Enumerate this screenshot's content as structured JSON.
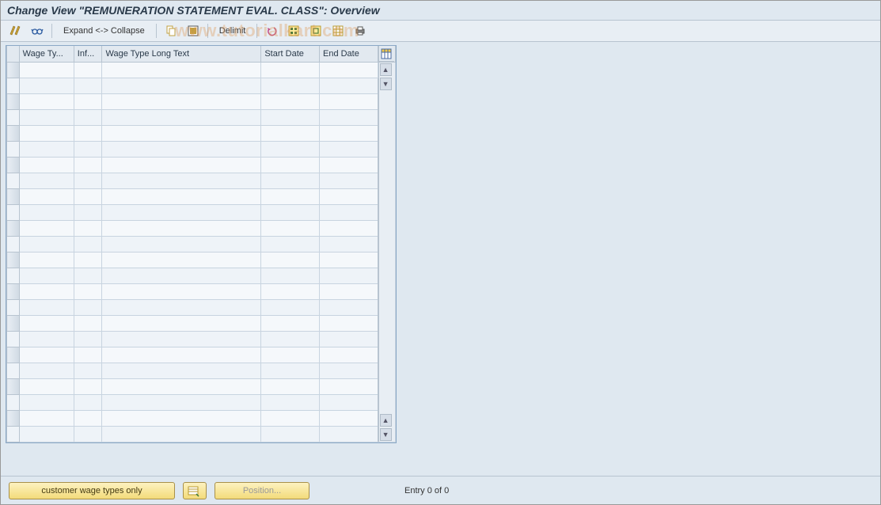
{
  "title": "Change View \"REMUNERATION STATEMENT EVAL. CLASS\": Overview",
  "toolbar": {
    "expand_collapse_label": "Expand <-> Collapse",
    "delimit_label": "Delimit"
  },
  "watermark": "www.tutorialkart.com",
  "table": {
    "columns": [
      "Wage Ty...",
      "Inf...",
      "Wage Type Long Text",
      "Start Date",
      "End Date"
    ],
    "row_count": 24
  },
  "footer": {
    "customer_wage_types_label": "customer wage types only",
    "position_label": "Position...",
    "entry_status": "Entry 0 of 0"
  }
}
